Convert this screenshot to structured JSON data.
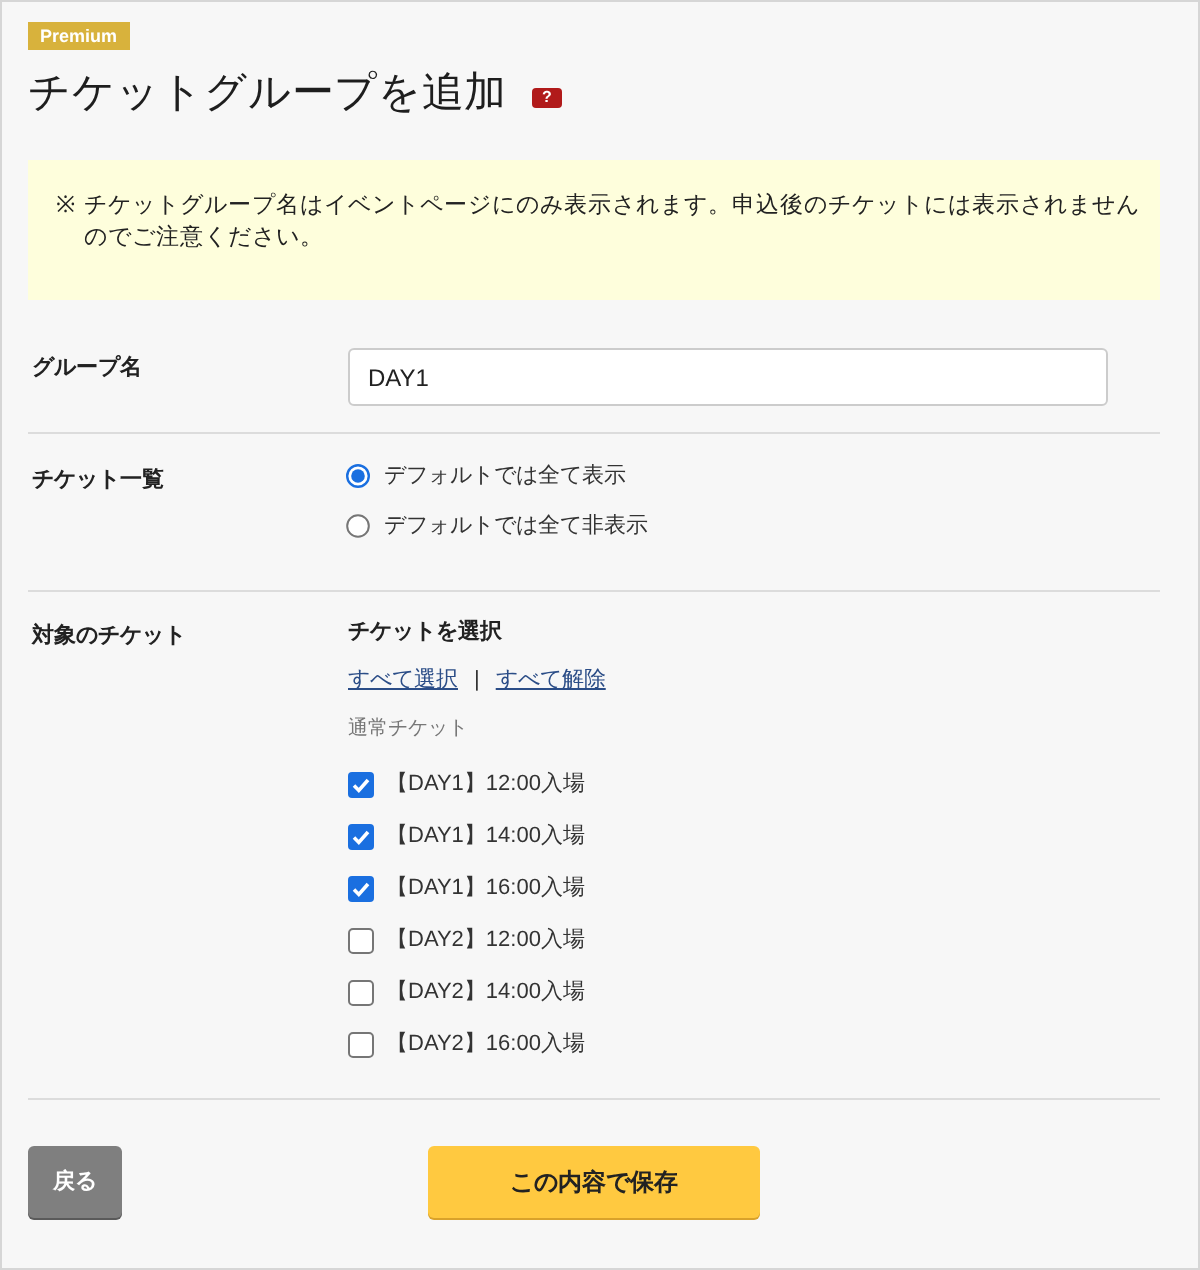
{
  "badge": "Premium",
  "title": "チケットグループを追加",
  "help": "?",
  "notice": {
    "mark": "※",
    "text": "チケットグループ名はイベントページにのみ表示されます。申込後のチケットには表示されませんのでご注意ください。"
  },
  "group_name": {
    "label": "グループ名",
    "value": "DAY1"
  },
  "ticket_list": {
    "label": "チケット一覧",
    "options": [
      {
        "label": "デフォルトでは全て表示",
        "selected": true
      },
      {
        "label": "デフォルトでは全て非表示",
        "selected": false
      }
    ]
  },
  "target_tickets": {
    "label": "対象のチケット",
    "heading": "チケットを選択",
    "links": [
      "すべて選択",
      "すべて解除"
    ],
    "separator": "|",
    "category": "通常チケット",
    "tickets": [
      {
        "label": "【DAY1】12:00入場",
        "checked": true
      },
      {
        "label": "【DAY1】14:00入場",
        "checked": true
      },
      {
        "label": "【DAY1】16:00入場",
        "checked": true
      },
      {
        "label": "【DAY2】12:00入場",
        "checked": false
      },
      {
        "label": "【DAY2】14:00入場",
        "checked": false
      },
      {
        "label": "【DAY2】16:00入場",
        "checked": false
      }
    ]
  },
  "buttons": {
    "back": "戻る",
    "save": "この内容で保存"
  }
}
